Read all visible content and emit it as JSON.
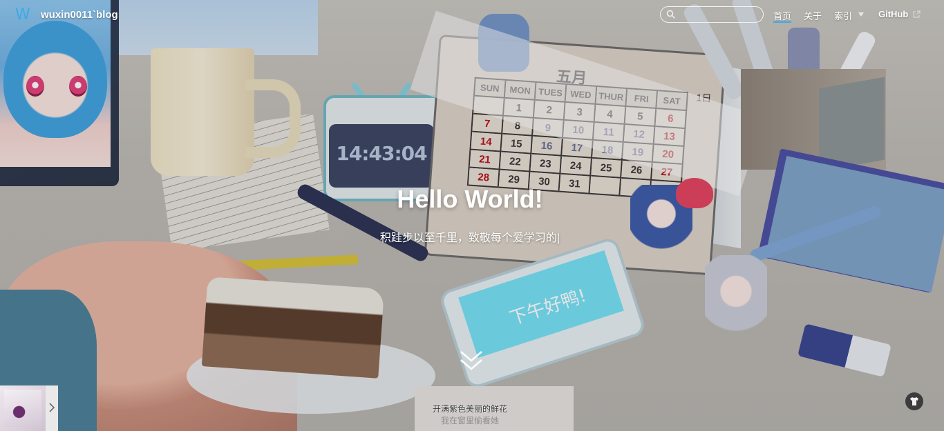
{
  "header": {
    "logo_letter": "W",
    "site_title": "wuxin0011`blog",
    "search": {
      "placeholder": ""
    },
    "nav": {
      "home": "首页",
      "about": "关于",
      "index": "索引",
      "github": "GitHub"
    },
    "accent_color": "#3fa9e8"
  },
  "hero": {
    "title": "Hello World!",
    "subtitle": "积跬步以至千里，致敬每个爱学习的|"
  },
  "background": {
    "clock_time": "14:43:04",
    "calendar_month": "五月",
    "calendar_day_label": "1日",
    "calendar_headers": [
      "SUN",
      "MON",
      "TUES",
      "WED",
      "THUR",
      "FRI",
      "SAT"
    ],
    "calendar_days": [
      "",
      "1",
      "2",
      "3",
      "4",
      "5",
      "6",
      "7",
      "8",
      "9",
      "10",
      "11",
      "12",
      "13",
      "14",
      "15",
      "16",
      "17",
      "18",
      "19",
      "20",
      "21",
      "22",
      "23",
      "24",
      "25",
      "26",
      "27",
      "28",
      "29",
      "30",
      "31",
      "",
      "",
      ""
    ],
    "phone_text": "下午好鸭!"
  },
  "player": {
    "lyric_current": "开满紫色美丽的鲜花",
    "lyric_next": "我在窗里偷看她"
  },
  "icons": {
    "search": "search-icon",
    "chevron_down": "chevron-down-icon",
    "external_link": "external-link-icon",
    "scroll_down": "scroll-down-icon",
    "chevron_right": "chevron-right-icon",
    "tshirt": "tshirt-icon"
  }
}
